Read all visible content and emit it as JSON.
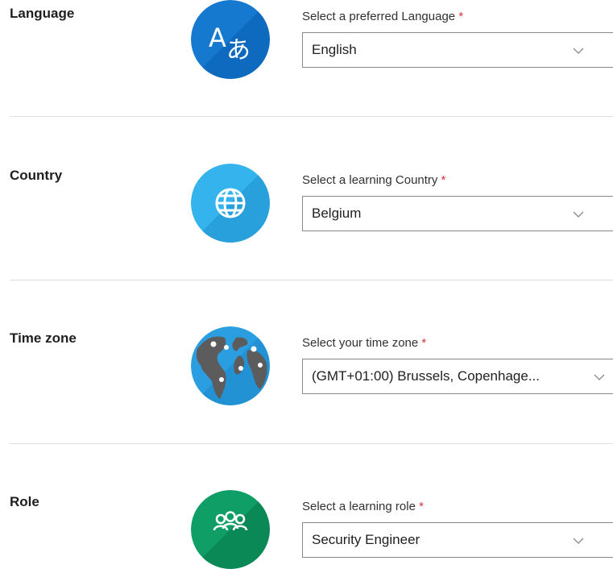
{
  "sections": [
    {
      "title": "Language",
      "field_label": "Select a preferred Language",
      "required_mark": "*",
      "value": "English",
      "icon": "language-icon",
      "color": "#0f6cbd"
    },
    {
      "title": "Country",
      "field_label": "Select a learning Country",
      "required_mark": "*",
      "value": "Belgium",
      "icon": "globe-icon",
      "color": "#2aa0e0"
    },
    {
      "title": "Time zone",
      "field_label": "Select your time zone",
      "required_mark": "*",
      "value": "(GMT+01:00) Brussels, Copenhage...",
      "icon": "world-map-icon",
      "color": "#2596d8"
    },
    {
      "title": "Role",
      "field_label": "Select a learning role",
      "required_mark": "*",
      "value": "Security Engineer",
      "icon": "people-group-icon",
      "color": "#0b8a5a"
    }
  ],
  "dropdown_icon": "chevron-down-icon"
}
